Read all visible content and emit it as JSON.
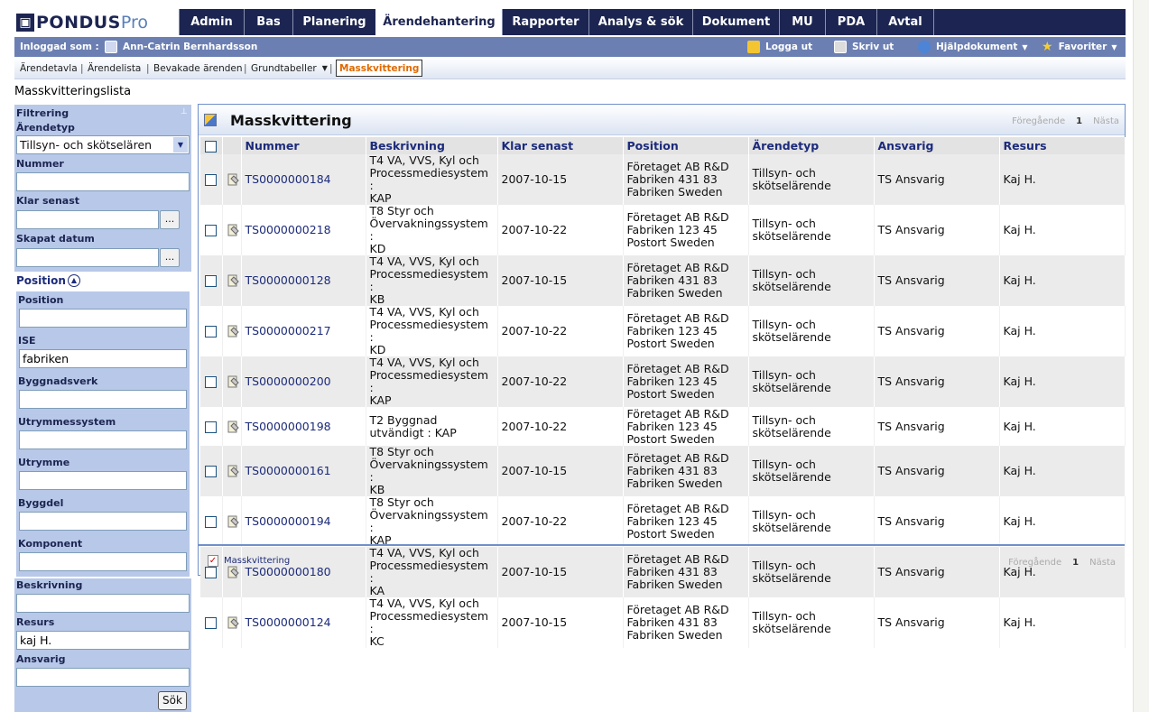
{
  "logo": {
    "text_a": "PONDUS",
    "text_b": "Pro"
  },
  "nav": {
    "tabs": [
      "Admin",
      "Bas",
      "Planering",
      "Ärendehantering",
      "Rapporter",
      "Analys & sök",
      "Dokument",
      "MU",
      "PDA",
      "Avtal"
    ],
    "active": "Ärendehantering"
  },
  "userbar": {
    "logged_in_label": "Inloggad som :",
    "user_name": "Ann-Catrin Bernhardsson",
    "logout": "Logga ut",
    "print": "Skriv ut",
    "help": "Hjälpdokument",
    "favorites": "Favoriter"
  },
  "subnav": {
    "items": [
      "Ärendetavla",
      "Ärendelista",
      "Bevakade ärenden",
      "Grundtabeller",
      "Masskvittering"
    ],
    "separators": [
      "|",
      "|",
      "|",
      "|"
    ]
  },
  "page_title": "Masskvitteringslista",
  "filter": {
    "title": "Filtrering",
    "arendetyp_label": "Ärendetyp",
    "arendetyp_value": "Tillsyn- och skötselären",
    "nummer_label": "Nummer",
    "klar_label": "Klar senast",
    "skapat_label": "Skapat datum",
    "browse_btn": "...",
    "position_header": "Position",
    "position_label": "Position",
    "ise_label": "ISE",
    "ise_value": "fabriken",
    "byggnadsverk_label": "Byggnadsverk",
    "utrymmessystem_label": "Utrymmessystem",
    "utrymme_label": "Utrymme",
    "byggdel_label": "Byggdel",
    "komponent_label": "Komponent",
    "beskrivning_label": "Beskrivning",
    "resurs_label": "Resurs",
    "resurs_value": "kaj H.",
    "ansvarig_label": "Ansvarig",
    "search_btn": "Sök"
  },
  "main": {
    "title": "Masskvittering",
    "pager_prev": "Föregående",
    "pager_page": "1",
    "pager_next": "Nästa",
    "columns": [
      "Nummer",
      "Beskrivning",
      "Klar senast",
      "Position",
      "Ärendetyp",
      "Ansvarig",
      "Resurs"
    ],
    "rows": [
      {
        "nummer": "TS0000000184",
        "beskrivning": [
          "T4 VA, VVS, Kyl och",
          "Processmediesystem :",
          "KAP"
        ],
        "klar": "2007-10-15",
        "position": [
          "Företaget AB R&D",
          "Fabriken 431 83",
          "Fabriken Sweden"
        ],
        "typ": [
          "Tillsyn- och",
          "skötselärende"
        ],
        "ansvarig": "TS Ansvarig",
        "resurs": "Kaj H."
      },
      {
        "nummer": "TS0000000218",
        "beskrivning": [
          "T8 Styr och",
          "Övervakningssystem :",
          "KD"
        ],
        "klar": "2007-10-22",
        "position": [
          "Företaget AB R&D",
          "Fabriken 123 45",
          "Postort Sweden"
        ],
        "typ": [
          "Tillsyn- och",
          "skötselärende"
        ],
        "ansvarig": "TS Ansvarig",
        "resurs": "Kaj H."
      },
      {
        "nummer": "TS0000000128",
        "beskrivning": [
          "T4 VA, VVS, Kyl och",
          "Processmediesystem :",
          "KB"
        ],
        "klar": "2007-10-15",
        "position": [
          "Företaget AB R&D",
          "Fabriken 431 83",
          "Fabriken Sweden"
        ],
        "typ": [
          "Tillsyn- och",
          "skötselärende"
        ],
        "ansvarig": "TS Ansvarig",
        "resurs": "Kaj H."
      },
      {
        "nummer": "TS0000000217",
        "beskrivning": [
          "T4 VA, VVS, Kyl och",
          "Processmediesystem :",
          "KD"
        ],
        "klar": "2007-10-22",
        "position": [
          "Företaget AB R&D",
          "Fabriken 123 45",
          "Postort Sweden"
        ],
        "typ": [
          "Tillsyn- och",
          "skötselärende"
        ],
        "ansvarig": "TS Ansvarig",
        "resurs": "Kaj H."
      },
      {
        "nummer": "TS0000000200",
        "beskrivning": [
          "T4 VA, VVS, Kyl och",
          "Processmediesystem :",
          "KAP"
        ],
        "klar": "2007-10-22",
        "position": [
          "Företaget AB R&D",
          "Fabriken 123 45",
          "Postort Sweden"
        ],
        "typ": [
          "Tillsyn- och",
          "skötselärende"
        ],
        "ansvarig": "TS Ansvarig",
        "resurs": "Kaj H."
      },
      {
        "nummer": "TS0000000198",
        "beskrivning": [
          "T2 Byggnad",
          "utvändigt : KAP"
        ],
        "klar": "2007-10-22",
        "position": [
          "Företaget AB R&D",
          "Fabriken 123 45",
          "Postort Sweden"
        ],
        "typ": [
          "Tillsyn- och",
          "skötselärende"
        ],
        "ansvarig": "TS Ansvarig",
        "resurs": "Kaj H."
      },
      {
        "nummer": "TS0000000161",
        "beskrivning": [
          "T8 Styr och",
          "Övervakningssystem :",
          "KB"
        ],
        "klar": "2007-10-15",
        "position": [
          "Företaget AB R&D",
          "Fabriken 431 83",
          "Fabriken Sweden"
        ],
        "typ": [
          "Tillsyn- och",
          "skötselärende"
        ],
        "ansvarig": "TS Ansvarig",
        "resurs": "Kaj H."
      },
      {
        "nummer": "TS0000000194",
        "beskrivning": [
          "T8 Styr och",
          "Övervakningssystem :",
          "KAP"
        ],
        "klar": "2007-10-22",
        "position": [
          "Företaget AB R&D",
          "Fabriken 123 45",
          "Postort Sweden"
        ],
        "typ": [
          "Tillsyn- och",
          "skötselärende"
        ],
        "ansvarig": "TS Ansvarig",
        "resurs": "Kaj H."
      },
      {
        "nummer": "TS0000000180",
        "beskrivning": [
          "T4 VA, VVS, Kyl och",
          "Processmediesystem :",
          "KA"
        ],
        "klar": "2007-10-15",
        "position": [
          "Företaget AB R&D",
          "Fabriken 431 83",
          "Fabriken Sweden"
        ],
        "typ": [
          "Tillsyn- och",
          "skötselärende"
        ],
        "ansvarig": "TS Ansvarig",
        "resurs": "Kaj H."
      },
      {
        "nummer": "TS0000000124",
        "beskrivning": [
          "T4 VA, VVS, Kyl och",
          "Processmediesystem :",
          "KC"
        ],
        "klar": "2007-10-15",
        "position": [
          "Företaget AB R&D",
          "Fabriken 431 83",
          "Fabriken Sweden"
        ],
        "typ": [
          "Tillsyn- och",
          "skötselärende"
        ],
        "ansvarig": "TS Ansvarig",
        "resurs": "Kaj H."
      }
    ],
    "footer_link": "Masskvittering"
  }
}
